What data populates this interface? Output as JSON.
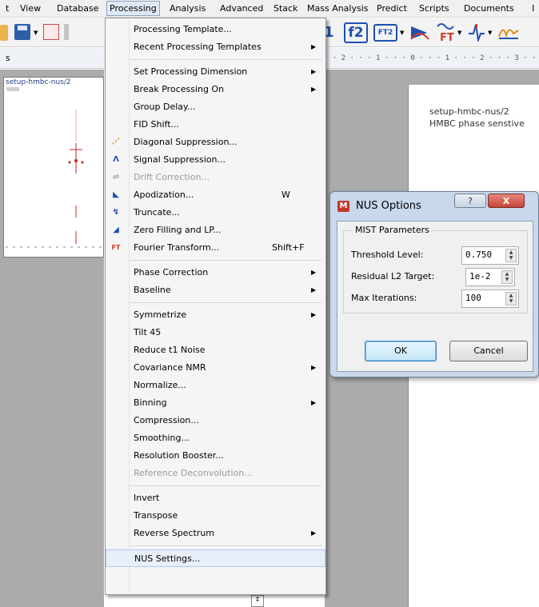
{
  "menubar": {
    "items": [
      "t",
      "View",
      "Database",
      "Processing",
      "Analysis",
      "Advanced",
      "Stack",
      "Mass Analysis",
      "Predict",
      "Scripts",
      "Documents",
      "I"
    ]
  },
  "panel": {
    "left_label": "s",
    "thumb_title": "setup-hmbc-nus/2",
    "ruler": "· · 2 · · · 1 · · · 0 · · · 1 · · · 2 · · · 3 · · ·"
  },
  "toolbar": {
    "f1_label": "1",
    "f2_label": "f2",
    "ft2_label": "FT2"
  },
  "document": {
    "line1": "setup-hmbc-nus/2",
    "line2": "HMBC phase senstive"
  },
  "menu": {
    "items": [
      {
        "label": "Processing Template...",
        "shortcut": "",
        "submenu": false,
        "disabled": false,
        "icon": ""
      },
      {
        "label": "Recent Processing Templates",
        "shortcut": "",
        "submenu": true,
        "disabled": false,
        "icon": ""
      },
      {
        "label": "Set Processing Dimension",
        "shortcut": "",
        "submenu": true,
        "disabled": false,
        "icon": ""
      },
      {
        "label": "Break Processing On",
        "shortcut": "",
        "submenu": true,
        "disabled": false,
        "icon": ""
      },
      {
        "label": "Group Delay...",
        "shortcut": "",
        "submenu": false,
        "disabled": false,
        "icon": ""
      },
      {
        "label": "FID Shift...",
        "shortcut": "",
        "submenu": false,
        "disabled": false,
        "icon": ""
      },
      {
        "label": "Diagonal Suppression...",
        "shortcut": "",
        "submenu": false,
        "disabled": false,
        "icon": "diagonal-suppression-icon"
      },
      {
        "label": "Signal Suppression...",
        "shortcut": "",
        "submenu": false,
        "disabled": false,
        "icon": "signal-suppression-icon"
      },
      {
        "label": "Drift Correction...",
        "shortcut": "",
        "submenu": false,
        "disabled": true,
        "icon": "drift-correction-icon"
      },
      {
        "label": "Apodization...",
        "shortcut": "W",
        "submenu": false,
        "disabled": false,
        "icon": "apodization-icon"
      },
      {
        "label": "Truncate...",
        "shortcut": "",
        "submenu": false,
        "disabled": false,
        "icon": "truncate-icon"
      },
      {
        "label": "Zero Filling and LP...",
        "shortcut": "",
        "submenu": false,
        "disabled": false,
        "icon": "zero-filling-icon"
      },
      {
        "label": "Fourier Transform...",
        "shortcut": "Shift+F",
        "submenu": false,
        "disabled": false,
        "icon": "fourier-transform-icon"
      },
      {
        "label": "Phase Correction",
        "shortcut": "",
        "submenu": true,
        "disabled": false,
        "icon": ""
      },
      {
        "label": "Baseline",
        "shortcut": "",
        "submenu": true,
        "disabled": false,
        "icon": ""
      },
      {
        "label": "Symmetrize",
        "shortcut": "",
        "submenu": true,
        "disabled": false,
        "icon": ""
      },
      {
        "label": "Tilt 45",
        "shortcut": "",
        "submenu": false,
        "disabled": false,
        "icon": ""
      },
      {
        "label": "Reduce t1 Noise",
        "shortcut": "",
        "submenu": false,
        "disabled": false,
        "icon": ""
      },
      {
        "label": "Covariance NMR",
        "shortcut": "",
        "submenu": true,
        "disabled": false,
        "icon": ""
      },
      {
        "label": "Normalize...",
        "shortcut": "",
        "submenu": false,
        "disabled": false,
        "icon": ""
      },
      {
        "label": "Binning",
        "shortcut": "",
        "submenu": true,
        "disabled": false,
        "icon": ""
      },
      {
        "label": "Compression...",
        "shortcut": "",
        "submenu": false,
        "disabled": false,
        "icon": ""
      },
      {
        "label": "Smoothing...",
        "shortcut": "",
        "submenu": false,
        "disabled": false,
        "icon": ""
      },
      {
        "label": "Resolution Booster...",
        "shortcut": "",
        "submenu": false,
        "disabled": false,
        "icon": ""
      },
      {
        "label": "Reference Deconvolution...",
        "shortcut": "",
        "submenu": false,
        "disabled": true,
        "icon": ""
      },
      {
        "label": "Invert",
        "shortcut": "",
        "submenu": false,
        "disabled": false,
        "icon": ""
      },
      {
        "label": "Transpose",
        "shortcut": "",
        "submenu": false,
        "disabled": false,
        "icon": ""
      },
      {
        "label": "Reverse Spectrum",
        "shortcut": "",
        "submenu": true,
        "disabled": false,
        "icon": ""
      },
      {
        "label": "NUS Settings...",
        "shortcut": "",
        "submenu": false,
        "disabled": false,
        "icon": "",
        "highlighted": true
      }
    ]
  },
  "dialog": {
    "title": "NUS Options",
    "group_title": "MIST Parameters",
    "threshold_label": "Threshold Level:",
    "threshold_value": "0.750",
    "residual_label": "Residual L2 Target:",
    "residual_value": "1e-2",
    "iterations_label": "Max Iterations:",
    "iterations_value": "100",
    "ok_label": "OK",
    "cancel_label": "Cancel",
    "help_label": "?",
    "close_label": "X"
  },
  "colors": {
    "menu_highlight": "#e8eff9",
    "dialog_frame": "#c9d8ea",
    "close_button": "#c7463a",
    "toolbar_blue": "#1f4fb0"
  }
}
